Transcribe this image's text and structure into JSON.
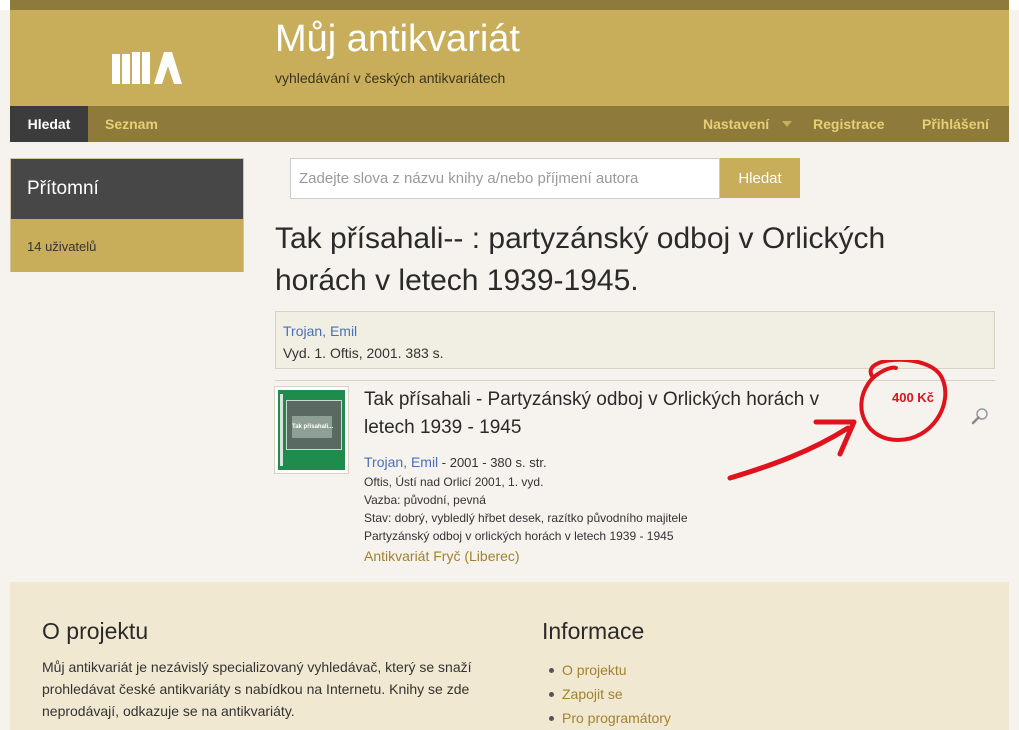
{
  "header": {
    "title": "Můj antikvariát",
    "subtitle": "vyhledávání v českých antikvariátech"
  },
  "nav": {
    "search": "Hledat",
    "list": "Seznam",
    "settings": "Nastavení",
    "register": "Registrace",
    "login": "Přihlášení"
  },
  "sidebar": {
    "heading": "Přítomní",
    "users": "14 uživatelů"
  },
  "search": {
    "placeholder": "Zadejte slova z názvu knihy a/nebo příjmení autora",
    "value": "",
    "button": "Hledat"
  },
  "book": {
    "title": "Tak přísahali-- : partyzánský odboj v Orlických horách v letech 1939-1945.",
    "author": "Trojan, Emil",
    "edition": "Vyd. 1. Oftis, 2001. 383 s."
  },
  "listing": {
    "title": "Tak přísahali - Partyzánský odboj v Orlických horách v letech 1939 - 1945",
    "author": "Trojan, Emil",
    "details": " - 2001 - 380 s. str.",
    "publisher": "Oftis, Ústí nad Orlicí 2001, 1. vyd.",
    "binding": "Vazba: původní, pevná",
    "condition": "Stav: dobrý, vybledlý hřbet desek, razítko původního majitele",
    "subtitle": "Partyzánský odboj v orlických horách v letech 1939 - 1945",
    "shop": "Antikvariát Fryč (Liberec)",
    "price": "400 Kč",
    "cover_text": "Tak přísahali..."
  },
  "footer": {
    "about_heading": "O projektu",
    "about_text": "Můj antikvariát je nezávislý specializovaný vyhledávač, který se snaží prohledávat české antikvariáty s nabídkou na Internetu. Knihy se zde neprodávají, odkazuje se na antikvariáty.",
    "info_heading": "Informace",
    "info_links": [
      "O projektu",
      "Zapojit se",
      "Pro programátory"
    ]
  },
  "colors": {
    "brand": "#c8ae5a",
    "brand_dark": "#8e7b3c",
    "annotation": "#d9141f"
  },
  "icons": {
    "logo": "logo-books-icon",
    "zoom": "magnifier-icon",
    "caret": "caret-down-icon"
  }
}
